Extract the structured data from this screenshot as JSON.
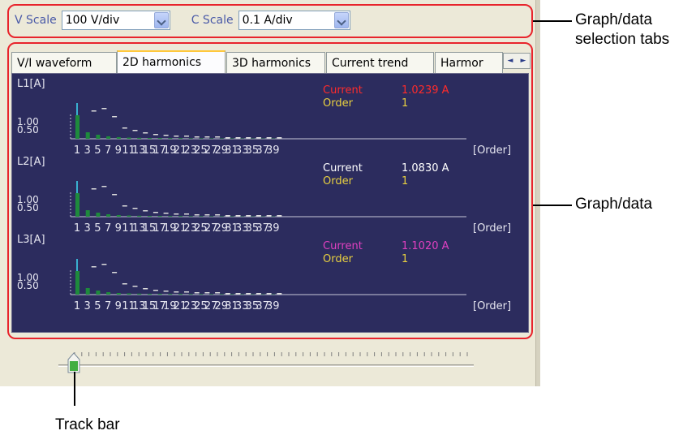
{
  "scale_bar": {
    "v_scale_label": "V Scale",
    "v_scale_value": "100 V/div",
    "c_scale_label": "C Scale",
    "c_scale_value": "0.1 A/div"
  },
  "tabs": [
    {
      "label": "V/I waveform",
      "active": false
    },
    {
      "label": "2D harmonics",
      "active": true
    },
    {
      "label": "3D harmonics",
      "active": false
    },
    {
      "label": "Current trend",
      "active": false
    },
    {
      "label": "Harmor",
      "active": false
    }
  ],
  "tab_scroll": {
    "left": "◄",
    "right": "►"
  },
  "graph": {
    "current_label": "Current",
    "order_label": "Order",
    "x_unit_label": "[Order]",
    "y_ticks": [
      "1.00",
      "0.50"
    ],
    "order_ticks": [
      "1",
      "3",
      "5",
      "7",
      "9",
      "11",
      "13",
      "15",
      "17",
      "19",
      "21",
      "23",
      "25",
      "27",
      "29",
      "31",
      "33",
      "35",
      "37",
      "39"
    ],
    "colors": {
      "background": "#2c2c5e",
      "bar": "#1e8a3c",
      "fundamental_line": "#3ab0d0",
      "axis": "#c8c8d8",
      "order_value": "#e8d040"
    },
    "channels": [
      {
        "name": "L1[A]",
        "current_value": "1.0239 A",
        "order_value": "1",
        "color": "#ff2b2b"
      },
      {
        "name": "L2[A]",
        "current_value": "1.0830 A",
        "order_value": "1",
        "color": "#ffffff"
      },
      {
        "name": "L3[A]",
        "current_value": "1.1020 A",
        "order_value": "1",
        "color": "#e040c0"
      }
    ]
  },
  "callouts": {
    "tabs_line1": "Graph/data",
    "tabs_line2": "selection tabs",
    "graph": "Graph/data",
    "trackbar": "Track bar"
  },
  "trackbar": {
    "position": 0
  }
}
